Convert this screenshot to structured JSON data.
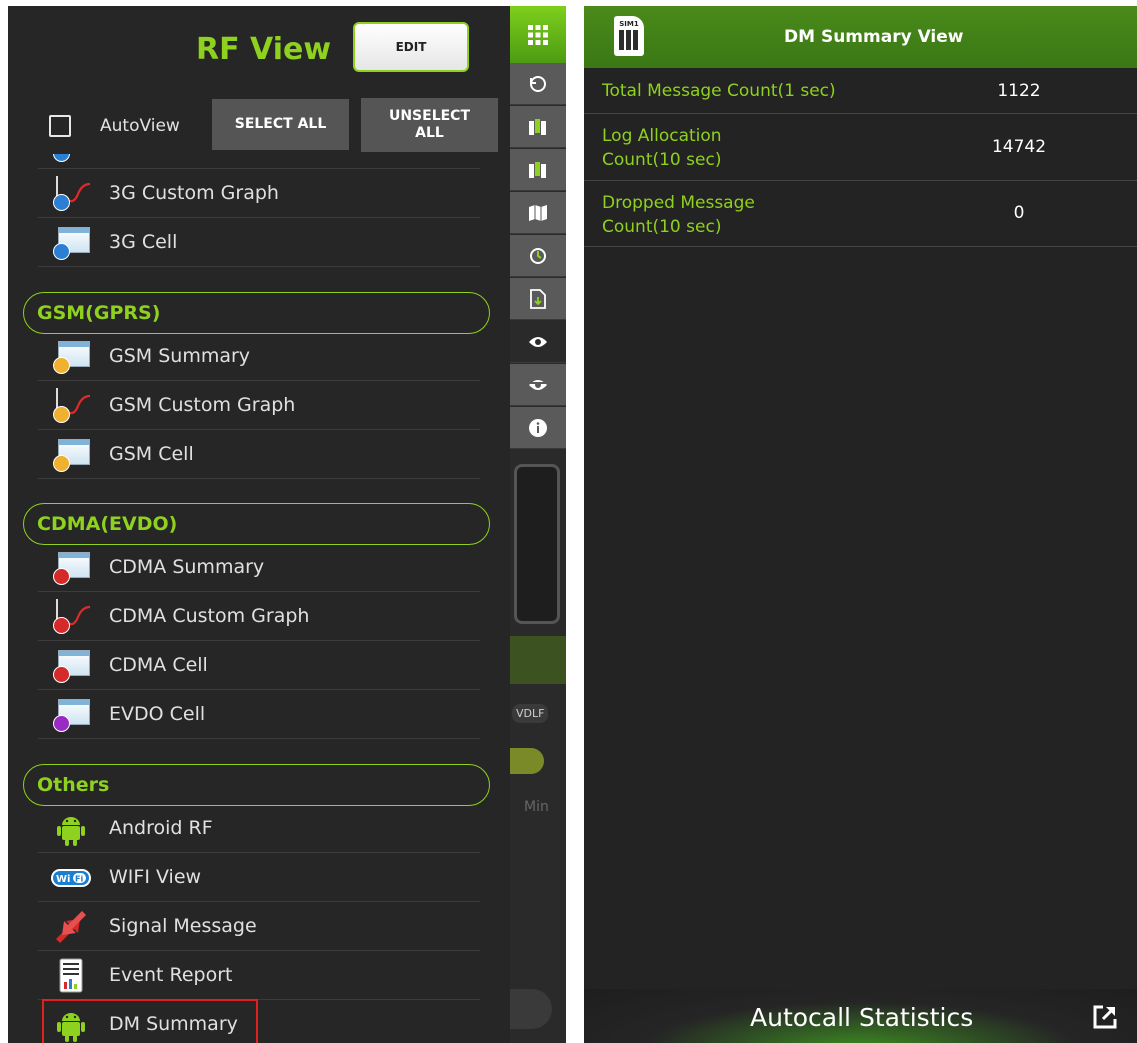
{
  "left": {
    "title": "RF View",
    "edit_label": "EDIT",
    "autoview_label": "AutoView",
    "select_all_label": "SELECT ALL",
    "unselect_all_label": "UNSELECT ALL",
    "items_3g": [
      {
        "label": "3G Custom Graph",
        "icon": "graph-icon",
        "dot_color": "#2a7fd4"
      },
      {
        "label": "3G Cell",
        "icon": "cell-window-icon",
        "dot_color": "#2a7fd4"
      }
    ],
    "section_gsm": "GSM(GPRS)",
    "items_gsm": [
      {
        "label": "GSM Summary",
        "icon": "summary-window-icon",
        "dot_color": "#f0b030"
      },
      {
        "label": "GSM Custom Graph",
        "icon": "graph-icon",
        "dot_color": "#f0b030"
      },
      {
        "label": "GSM Cell",
        "icon": "cell-window-icon",
        "dot_color": "#f0b030"
      }
    ],
    "section_cdma": "CDMA(EVDO)",
    "items_cdma": [
      {
        "label": "CDMA Summary",
        "icon": "summary-window-icon",
        "dot_color": "#d42a2a"
      },
      {
        "label": "CDMA Custom Graph",
        "icon": "graph-icon",
        "dot_color": "#d42a2a"
      },
      {
        "label": "CDMA Cell",
        "icon": "cell-window-icon",
        "dot_color": "#d42a2a"
      },
      {
        "label": "EVDO Cell",
        "icon": "cell-window-icon",
        "dot_color": "#9a2ac4"
      }
    ],
    "section_others": "Others",
    "items_others": [
      {
        "label": "Android RF",
        "icon": "android-icon"
      },
      {
        "label": "WIFI View",
        "icon": "wifi-icon"
      },
      {
        "label": "Signal Message",
        "icon": "signal-arrows-icon"
      },
      {
        "label": "Event Report",
        "icon": "report-icon"
      },
      {
        "label": "DM Summary",
        "icon": "android-icon"
      }
    ],
    "rail": {
      "vdlf_label": "VDLF",
      "min_label": "Min",
      "icons": [
        "grid-icon",
        "refresh-icon",
        "map-icon",
        "map-icon",
        "map-fold-icon",
        "history-icon",
        "file-download-icon",
        "eye-icon",
        "eye-crossed-icon",
        "info-icon"
      ]
    },
    "colors": {
      "accent": "#8ed11e",
      "highlight": "#e0211d"
    }
  },
  "right": {
    "header_title": "DM Summary View",
    "sim_label": "SIM1",
    "rows": [
      {
        "label": "Total Message Count(1 sec)",
        "value": "1122"
      },
      {
        "label": "Log Allocation Count(10 sec)",
        "value": "14742"
      },
      {
        "label": "Dropped Message Count(10 sec)",
        "value": "0"
      }
    ],
    "footer_label": "Autocall Statistics",
    "footer_icon": "export-icon"
  }
}
